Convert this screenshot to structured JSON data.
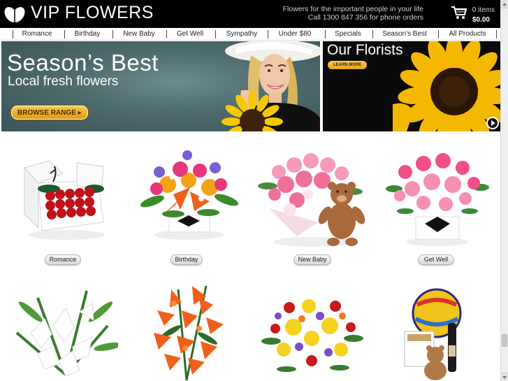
{
  "header": {
    "logo_text": "VIP FLOWERS",
    "tagline_line1": "Flowers for the important people in your life",
    "tagline_line2": "Call 1300 847 356 for phone orders",
    "cart_count": "0 items",
    "cart_total": "$0.00"
  },
  "nav": {
    "items": [
      {
        "label": "Romance"
      },
      {
        "label": "Birthday"
      },
      {
        "label": "New Baby"
      },
      {
        "label": "Get Well"
      },
      {
        "label": "Sympathy"
      },
      {
        "label": "Under $80"
      },
      {
        "label": "Specials"
      },
      {
        "label": "Season's Best"
      },
      {
        "label": "All Products"
      }
    ]
  },
  "hero": {
    "title": "Season’s Best",
    "subtitle": "Local fresh flowers",
    "button_label": "BROWSE RANGE ▸"
  },
  "promo": {
    "title": "Our Florists",
    "button_label": "LEARN MORE"
  },
  "products": [
    {
      "label": "Romance",
      "icon": "red-roses-box-icon"
    },
    {
      "label": "Birthday",
      "icon": "birthday-bouquet-icon"
    },
    {
      "label": "New Baby",
      "icon": "pink-bouquet-teddy-icon"
    },
    {
      "label": "Get Well",
      "icon": "pink-roses-box-icon"
    },
    {
      "label": "",
      "icon": "white-lilies-icon"
    },
    {
      "label": "",
      "icon": "orange-lilies-icon"
    },
    {
      "label": "",
      "icon": "mixed-bouquet-icon"
    },
    {
      "label": "",
      "icon": "balloon-gift-hamper-icon"
    }
  ],
  "colors": {
    "header_bg": "#000000",
    "hero_bg": "#4d6a6d",
    "button_gold": "#e8a81c",
    "accent_red": "#c0121a"
  }
}
